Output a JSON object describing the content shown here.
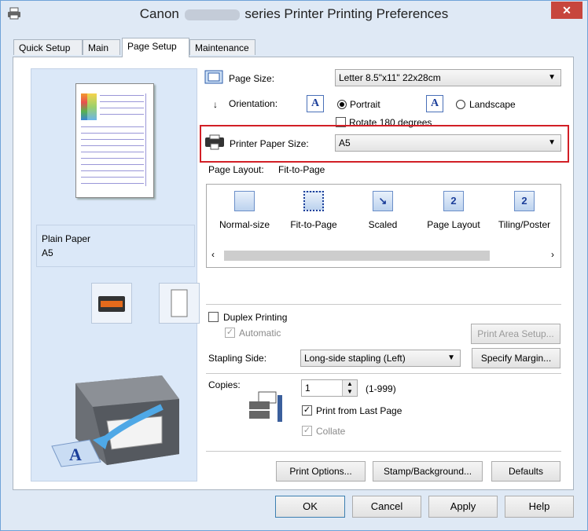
{
  "window": {
    "title_prefix": "Canon",
    "title_suffix": "series Printer Printing Preferences",
    "close_glyph": "✕"
  },
  "tabs": [
    {
      "label": "Quick Setup"
    },
    {
      "label": "Main"
    },
    {
      "label": "Page Setup",
      "active": true
    },
    {
      "label": "Maintenance"
    }
  ],
  "preview": {
    "media_type": "Plain Paper",
    "paper_size": "A5"
  },
  "page_size": {
    "label": "Page Size:",
    "value": "Letter 8.5\"x11\" 22x28cm"
  },
  "orientation": {
    "label": "Orientation:",
    "portrait": "Portrait",
    "landscape": "Landscape",
    "selected": "portrait",
    "rotate_label": "Rotate 180 degrees"
  },
  "printer_paper_size": {
    "label": "Printer Paper Size:",
    "value": "A5"
  },
  "page_layout": {
    "label": "Page Layout:",
    "value": "Fit-to-Page",
    "items": [
      {
        "label": "Normal-size"
      },
      {
        "label": "Fit-to-Page",
        "selected": true
      },
      {
        "label": "Scaled"
      },
      {
        "label": "Page Layout"
      },
      {
        "label": "Tiling/Poster"
      }
    ]
  },
  "duplex": {
    "label": "Duplex Printing",
    "automatic_label": "Automatic",
    "print_area_button": "Print Area Setup..."
  },
  "stapling": {
    "label": "Stapling Side:",
    "value": "Long-side stapling (Left)",
    "margin_button": "Specify Margin..."
  },
  "copies": {
    "label": "Copies:",
    "value": "1",
    "range": "(1-999)",
    "last_page_label": "Print from Last Page",
    "collate_label": "Collate"
  },
  "bottom_buttons": {
    "print_options": "Print Options...",
    "stamp_background": "Stamp/Background...",
    "defaults": "Defaults"
  },
  "dialog_buttons": {
    "ok": "OK",
    "cancel": "Cancel",
    "apply": "Apply",
    "help": "Help"
  },
  "colors": {
    "highlight_border": "#d21f26",
    "window_frame": "#dfe9f5",
    "preview_bg": "#dbe8f8"
  }
}
